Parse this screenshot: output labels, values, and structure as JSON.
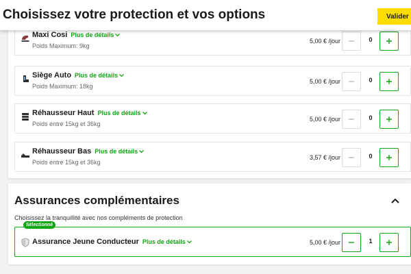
{
  "header": {
    "title": "Choisissez votre protection et vos options",
    "validate_label": "Valider"
  },
  "options": [
    {
      "name": "Maxi Cosi",
      "icon": "infant-car-seat-icon",
      "details_label": "Plus de détails",
      "subtitle": "Poids Maximum: 9kg",
      "price": "5,00 € /jour",
      "quantity": "0"
    },
    {
      "name": "Siège Auto",
      "icon": "child-car-seat-icon",
      "details_label": "Plus de détails",
      "subtitle": "Poids Maximum: 18kg",
      "price": "5,00 € /jour",
      "quantity": "0"
    },
    {
      "name": "Réhausseur Haut",
      "icon": "high-booster-seat-icon",
      "details_label": "Plus de détails",
      "subtitle": "Poids entre 15kg et 36kg",
      "price": "5,00 € /jour",
      "quantity": "0"
    },
    {
      "name": "Réhausseur Bas",
      "icon": "low-booster-seat-icon",
      "details_label": "Plus de détails",
      "subtitle": "Poids entre 15kg et 36kg",
      "price": "3,57 € /jour",
      "quantity": "0"
    }
  ],
  "insurance": {
    "title": "Assurances complémentaires",
    "description": "Choisissez la tranquillité avec nos compléments de protection",
    "item": {
      "badge": "Sélectionné",
      "name": "Assurance Jeune Conducteur",
      "icon": "shield-icon",
      "details_label": "Plus de détails",
      "price": "5,00 € /jour",
      "quantity": "1"
    }
  },
  "colors": {
    "accent_green": "#10a513",
    "validate_yellow": "#ffdd00"
  }
}
